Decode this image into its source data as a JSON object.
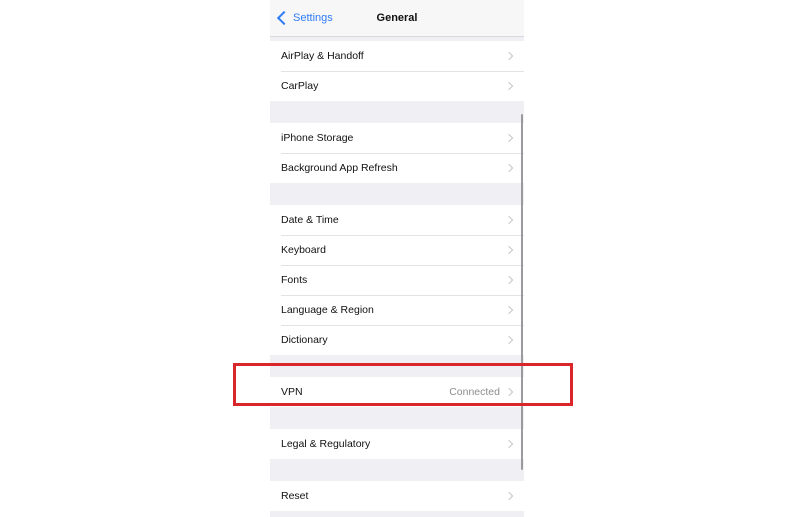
{
  "navbar": {
    "back_label": "Settings",
    "title": "General"
  },
  "groups": [
    {
      "rows": [
        {
          "label": "AirPlay & Handoff"
        },
        {
          "label": "CarPlay"
        }
      ]
    },
    {
      "rows": [
        {
          "label": "iPhone Storage"
        },
        {
          "label": "Background App Refresh"
        }
      ]
    },
    {
      "rows": [
        {
          "label": "Date & Time"
        },
        {
          "label": "Keyboard"
        },
        {
          "label": "Fonts"
        },
        {
          "label": "Language & Region"
        },
        {
          "label": "Dictionary"
        }
      ]
    },
    {
      "rows": [
        {
          "label": "VPN",
          "detail": "Connected"
        }
      ]
    },
    {
      "rows": [
        {
          "label": "Legal & Regulatory"
        }
      ]
    },
    {
      "rows": [
        {
          "label": "Reset"
        }
      ]
    }
  ],
  "colors": {
    "accent": "#2f7cf6",
    "highlight": "#d8262b",
    "background": "#efeff4"
  },
  "icons": {
    "back": "chevron-left-icon",
    "row": "chevron-right-icon"
  }
}
